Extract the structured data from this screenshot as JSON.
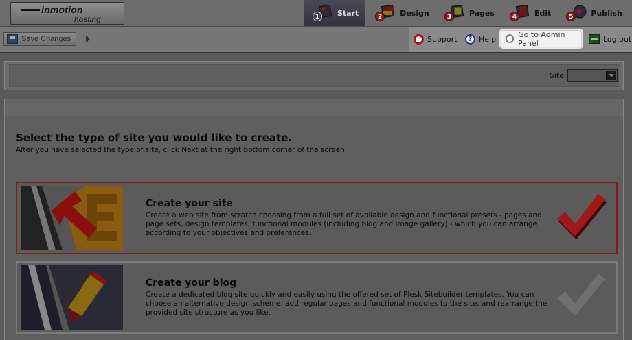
{
  "brand": {
    "logo_top": "inmotion",
    "logo_bottom": "hosting"
  },
  "steps": [
    {
      "num": "1",
      "label": "Start",
      "icon": "start-icon",
      "active": true
    },
    {
      "num": "2",
      "label": "Design",
      "icon": "design-icon",
      "active": false
    },
    {
      "num": "3",
      "label": "Pages",
      "icon": "pages-icon",
      "active": false
    },
    {
      "num": "4",
      "label": "Edit",
      "icon": "edit-icon",
      "active": false
    },
    {
      "num": "5",
      "label": "Publish",
      "icon": "publish-icon",
      "active": false
    }
  ],
  "toolbar": {
    "save_label": "Save Changes",
    "support_label": "Support",
    "help_label": "Help",
    "admin_label": "Go to Admin Panel",
    "logout_label": "Log out"
  },
  "filter": {
    "site_label": "Site",
    "site_value": ""
  },
  "main": {
    "title": "Select the type of site you would like to create.",
    "subtitle": "After you have selected the type of site, click Next at the right bottom corner of the screen."
  },
  "options": [
    {
      "title": "Create your site",
      "description": "Create a web site from scratch choosing from a full set of available design and functional presets - pages and page sets, design templates, functional modules (including blog and image gallery) - which you can arrange according to your objectives and preferences.",
      "selected": true
    },
    {
      "title": "Create your blog",
      "description": "Create a dedicated blog site quickly and easily using the offered set of Plesk Sitebuilder templates. You can choose an alternative design scheme, add regular pages and functional modules to the site, and rearrange the provided site structure as you like.",
      "selected": false
    }
  ],
  "colors": {
    "selected_border": "#8a1a1a",
    "check_selected": "#a01818",
    "check_unselected": "#6f6f6f",
    "step_badge": "#8a1d1d"
  }
}
